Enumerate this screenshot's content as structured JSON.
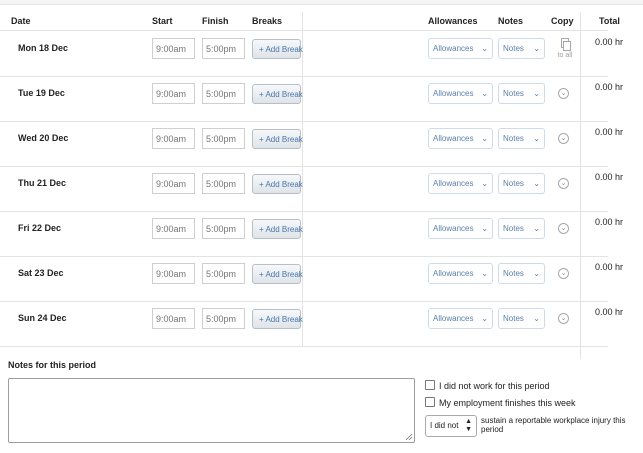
{
  "headers": {
    "date": "Date",
    "start": "Start",
    "finish": "Finish",
    "breaks": "Breaks",
    "allowances": "Allowances",
    "notes": "Notes",
    "copy": "Copy",
    "total": "Total"
  },
  "rows": [
    {
      "date": "Mon 18 Dec",
      "start_placeholder": "9:00am",
      "finish_placeholder": "5:00pm",
      "break_label": "+ Add Break",
      "allowances_label": "Allowances",
      "notes_label": "Notes",
      "total": "0.00 hr",
      "copy": "to all"
    },
    {
      "date": "Tue 19 Dec",
      "start_placeholder": "9:00am",
      "finish_placeholder": "5:00pm",
      "break_label": "+ Add Break",
      "allowances_label": "Allowances",
      "notes_label": "Notes",
      "total": "0.00 hr"
    },
    {
      "date": "Wed 20 Dec",
      "start_placeholder": "9:00am",
      "finish_placeholder": "5:00pm",
      "break_label": "+ Add Break",
      "allowances_label": "Allowances",
      "notes_label": "Notes",
      "total": "0.00 hr"
    },
    {
      "date": "Thu 21 Dec",
      "start_placeholder": "9:00am",
      "finish_placeholder": "5:00pm",
      "break_label": "+ Add Break",
      "allowances_label": "Allowances",
      "notes_label": "Notes",
      "total": "0.00 hr"
    },
    {
      "date": "Fri 22 Dec",
      "start_placeholder": "9:00am",
      "finish_placeholder": "5:00pm",
      "break_label": "+ Add Break",
      "allowances_label": "Allowances",
      "notes_label": "Notes",
      "total": "0.00 hr"
    },
    {
      "date": "Sat 23 Dec",
      "start_placeholder": "9:00am",
      "finish_placeholder": "5:00pm",
      "break_label": "+ Add Break",
      "allowances_label": "Allowances",
      "notes_label": "Notes",
      "total": "0.00 hr"
    },
    {
      "date": "Sun 24 Dec",
      "start_placeholder": "9:00am",
      "finish_placeholder": "5:00pm",
      "break_label": "+ Add Break",
      "allowances_label": "Allowances",
      "notes_label": "Notes",
      "total": "0.00 hr"
    }
  ],
  "icons": {
    "chevron": "chevron-down-icon",
    "copy_row": "copy-down-icon",
    "copy_all": "copy-documents-icon"
  },
  "period": {
    "notes_title": "Notes for this period",
    "notes_value": "",
    "did_not_work_label": "I did not work for this period",
    "employment_finishes_label": "My employment finishes this week",
    "injury_select_value": "I did not",
    "injury_text": "sustain a reportable workplace injury this period"
  },
  "colors": {
    "link_blue": "#4a76a8",
    "border_gray": "#cfcfcf"
  }
}
